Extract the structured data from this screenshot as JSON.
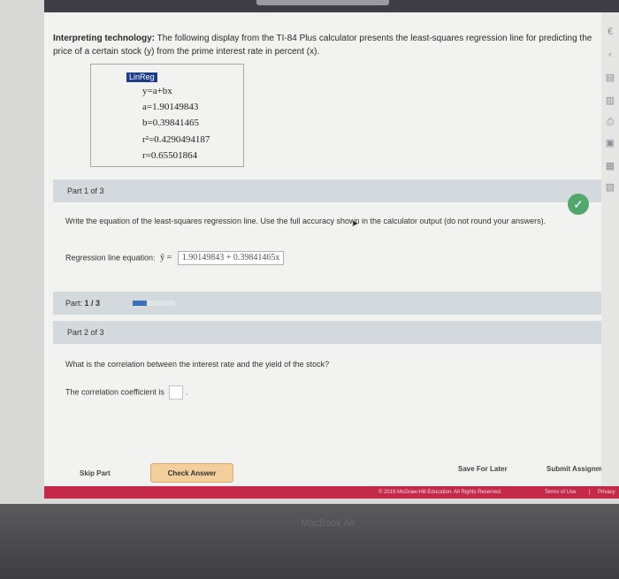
{
  "problem": {
    "lead_bold": "Interpreting technology:",
    "text": " The following display from the TI-84 Plus calculator presents the least-squares regression line for predicting the price of a certain stock (y) from the prime interest rate in percent (x)."
  },
  "calculator": {
    "header": "LinReg",
    "lines": [
      "y=a+bx",
      "a=1.90149843",
      "b=0.39841465",
      "r²=0.4290494187",
      "r=0.65501864"
    ]
  },
  "part1": {
    "header": "Part 1 of 3",
    "question": "Write the equation of the least-squares regression line. Use the full accuracy shown in the calculator output (do not round your answers).",
    "answer_label": "Regression line equation:",
    "answer_prefix": "ŷ =",
    "answer_value": "1.90149843 + 0.39841465x"
  },
  "progress": {
    "label_prefix": "Part:",
    "label_value": "1 / 3",
    "fraction": 0.33
  },
  "part2": {
    "header": "Part 2 of 3",
    "question": "What is the correlation between the interest rate and the yield of the stock?",
    "answer_label": "The correlation coefficient is",
    "answer_suffix": "."
  },
  "footer": {
    "skip": "Skip Part",
    "check": "Check Answer",
    "save": "Save For Later",
    "submit": "Submit Assignment"
  },
  "copyright": {
    "text": "© 2019 McGraw-Hill Education. All Rights Reserved.",
    "terms": "Terms of Use",
    "privacy": "Privacy"
  },
  "laptop_brand": "MacBook Air",
  "colors": {
    "check": "#52a86a",
    "progress": "#3a72b8",
    "check_button": "#f3cf9e",
    "footer_bar": "#c4294a"
  }
}
